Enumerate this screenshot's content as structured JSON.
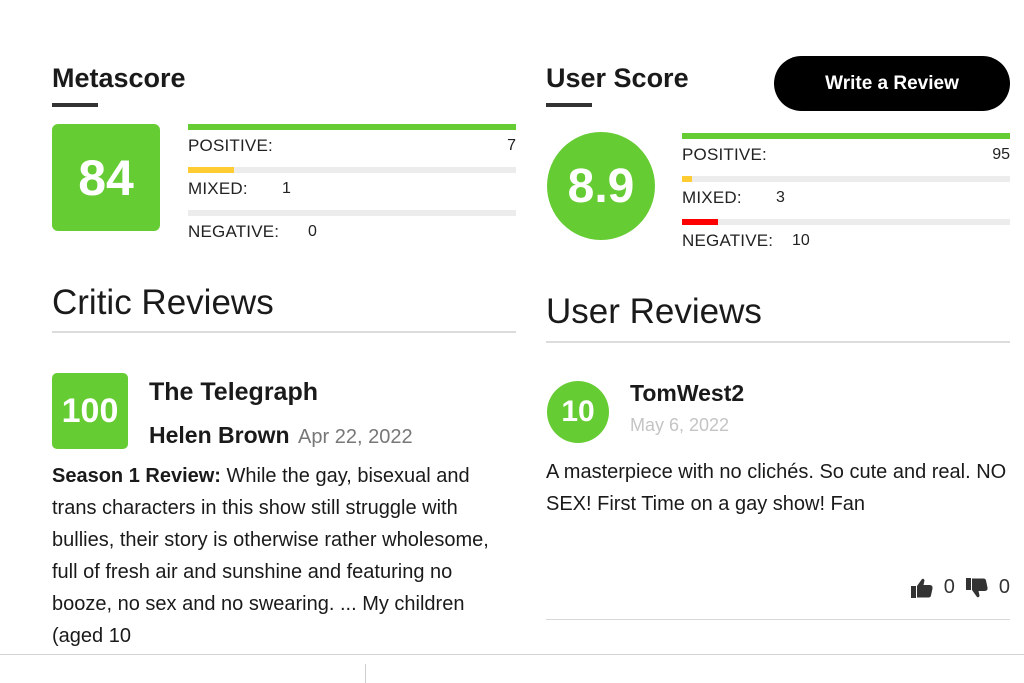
{
  "metascore": {
    "title": "Metascore",
    "score": "84",
    "score_color": "#66cc33",
    "distribution": [
      {
        "label": "POSITIVE:",
        "count": "7",
        "fraction": 1.0,
        "color": "#66cc33"
      },
      {
        "label": "MIXED:",
        "count": "1",
        "fraction": 0.14,
        "color": "#ffcc33"
      },
      {
        "label": "NEGATIVE:",
        "count": "0",
        "fraction": 0.0,
        "color": "#ff0000"
      }
    ]
  },
  "user_score": {
    "title": "User Score",
    "score": "8.9",
    "score_color": "#66cc33",
    "write_review_label": "Write a Review",
    "distribution": [
      {
        "label": "POSITIVE:",
        "count": "95",
        "fraction": 1.0,
        "color": "#66cc33"
      },
      {
        "label": "MIXED:",
        "count": "3",
        "fraction": 0.03,
        "color": "#ffcc33"
      },
      {
        "label": "NEGATIVE:",
        "count": "10",
        "fraction": 0.11,
        "color": "#ff0000"
      }
    ]
  },
  "critic_reviews": {
    "heading": "Critic Reviews",
    "items": [
      {
        "score": "100",
        "publication": "The Telegraph",
        "author": "Helen Brown",
        "date": "Apr 22, 2022",
        "summary_lead": "Season 1 Review:",
        "summary": " While the gay, bisexual and trans characters in this show still struggle with bullies, their story is otherwise rather wholesome, full of fresh air and sunshine and featuring no booze, no sex and no swearing. ... My children (aged 10"
      }
    ]
  },
  "user_reviews": {
    "heading": "User Reviews",
    "items": [
      {
        "score": "10",
        "username": "TomWest2",
        "date": "May 6, 2022",
        "text": "A masterpiece with no clichés. So cute and real. NO SEX! First Time on a gay show! Fan",
        "thumbs_up_icon": "thumbs-up-icon",
        "thumbs_up_count": "0",
        "thumbs_down_icon": "thumbs-down-icon",
        "thumbs_down_count": "0"
      }
    ]
  }
}
